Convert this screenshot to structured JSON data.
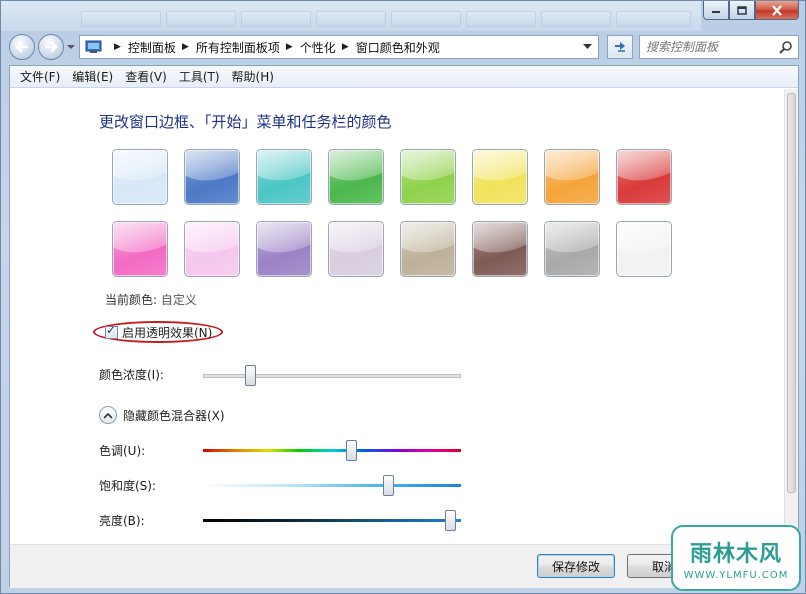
{
  "window": {
    "minimize_icon": "minimize-icon",
    "maximize_icon": "maximize-icon",
    "close_icon": "close-icon"
  },
  "address": {
    "breadcrumbs": [
      "控制面板",
      "所有控制面板项",
      "个性化",
      "窗口颜色和外观"
    ],
    "search_placeholder": "搜索控制面板"
  },
  "menu": [
    "文件(F)",
    "编辑(E)",
    "查看(V)",
    "工具(T)",
    "帮助(H)"
  ],
  "page": {
    "heading": "更改窗口边框、「开始」菜单和任务栏的颜色",
    "current_color_label": "当前颜色:",
    "current_color_value": "自定义",
    "transparency_label": "启用透明效果(N)",
    "transparency_checked": true,
    "intensity_label": "颜色浓度(I):",
    "intensity_value": 0.17,
    "mixer_label": "隐藏颜色混合器(X)",
    "hue_label": "色调(U):",
    "hue_value": 0.58,
    "saturation_label": "饱和度(S):",
    "saturation_value": 0.73,
    "brightness_label": "亮度(B):",
    "brightness_value": 0.98
  },
  "swatches": [
    "#d7e7f8",
    "#4c79c6",
    "#4cc6c6",
    "#4cb84c",
    "#8fd24c",
    "#f2e35c",
    "#f5a43a",
    "#d93a3a",
    "#f26bc4",
    "#f6c7ee",
    "#9b82c6",
    "#d9cde0",
    "#bdb198",
    "#7f5a55",
    "#a9a9a9",
    "#f2f2f2"
  ],
  "buttons": {
    "save": "保存修改",
    "cancel": "取消"
  },
  "watermark": {
    "main": "雨林木风",
    "sub": "WWW.YLMFU.COM"
  },
  "colors": {
    "heading": "#1e3287",
    "highlight_ellipse": "#c9151b",
    "watermark": "#2d9d95"
  }
}
